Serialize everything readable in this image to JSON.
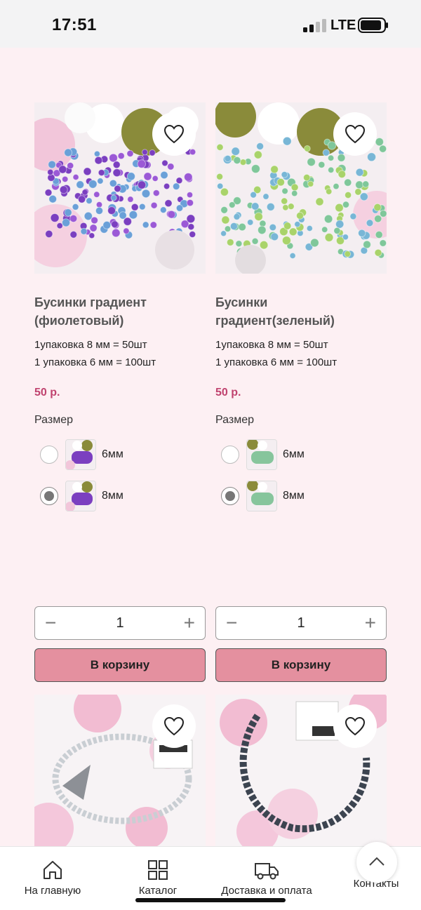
{
  "status_bar": {
    "time": "17:51",
    "network": "LTE"
  },
  "products": [
    {
      "title": "Бусинки градиент (фиолетовый)",
      "desc": [
        "1упаковка 8 мм = 50шт",
        "1 упаковка 6 мм = 100шт"
      ],
      "price": "50 р.",
      "size_label": "Размер",
      "options": [
        {
          "label": "6мм",
          "selected": false
        },
        {
          "label": "8мм",
          "selected": true
        }
      ],
      "quantity": "1",
      "cart_label": "В корзину",
      "bead_colors": [
        "#7b3fc0",
        "#9b59d6",
        "#6aa0d8"
      ]
    },
    {
      "title": "Бусинки градиент(зеленый)",
      "desc": [
        "1упаковка 8 мм = 50шт",
        "1 упаковка 6 мм = 100шт"
      ],
      "price": "50 р.",
      "size_label": "Размер",
      "options": [
        {
          "label": "6мм",
          "selected": false
        },
        {
          "label": "8мм",
          "selected": true
        }
      ],
      "quantity": "1",
      "cart_label": "В корзину",
      "bead_colors": [
        "#7fc79a",
        "#a9d36a",
        "#78b6d6"
      ]
    }
  ],
  "bottom_nav": [
    {
      "label": "На главную",
      "icon": "home-icon"
    },
    {
      "label": "Каталог",
      "icon": "catalog-grid-icon"
    },
    {
      "label": "Доставка и оплата",
      "icon": "truck-icon"
    },
    {
      "label": "Контакты",
      "icon": "contacts-icon"
    }
  ],
  "colors": {
    "background": "#fdf0f3",
    "price": "#c0436f",
    "cart_button": "#e4909f"
  }
}
